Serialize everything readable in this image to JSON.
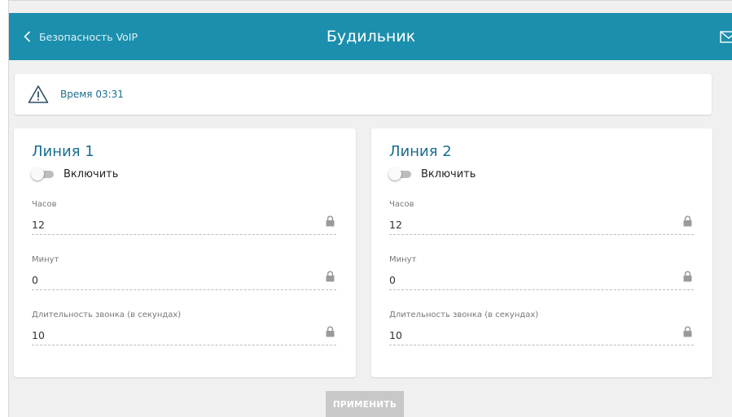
{
  "header": {
    "back_label": "Безопасность VoIP",
    "title": "Будильник",
    "brand_color": "#1b8fad"
  },
  "alert": {
    "text": "Время 03:31"
  },
  "lines": [
    {
      "title": "Линия 1",
      "toggle_label": "Включить",
      "enabled": false,
      "hours_label": "Часов",
      "hours_value": "12",
      "minutes_label": "Минут",
      "minutes_value": "0",
      "duration_label": "Длительность звонка (в секундах)",
      "duration_value": "10"
    },
    {
      "title": "Линия 2",
      "toggle_label": "Включить",
      "enabled": false,
      "hours_label": "Часов",
      "hours_value": "12",
      "minutes_label": "Минут",
      "minutes_value": "0",
      "duration_label": "Длительность звонка (в секундах)",
      "duration_value": "10"
    }
  ],
  "apply_label": "ПРИМЕНИТЬ",
  "icons": {
    "back": "chevron-left-icon",
    "mail": "mail-icon",
    "alert": "warning-icon",
    "lock": "lock-icon"
  }
}
